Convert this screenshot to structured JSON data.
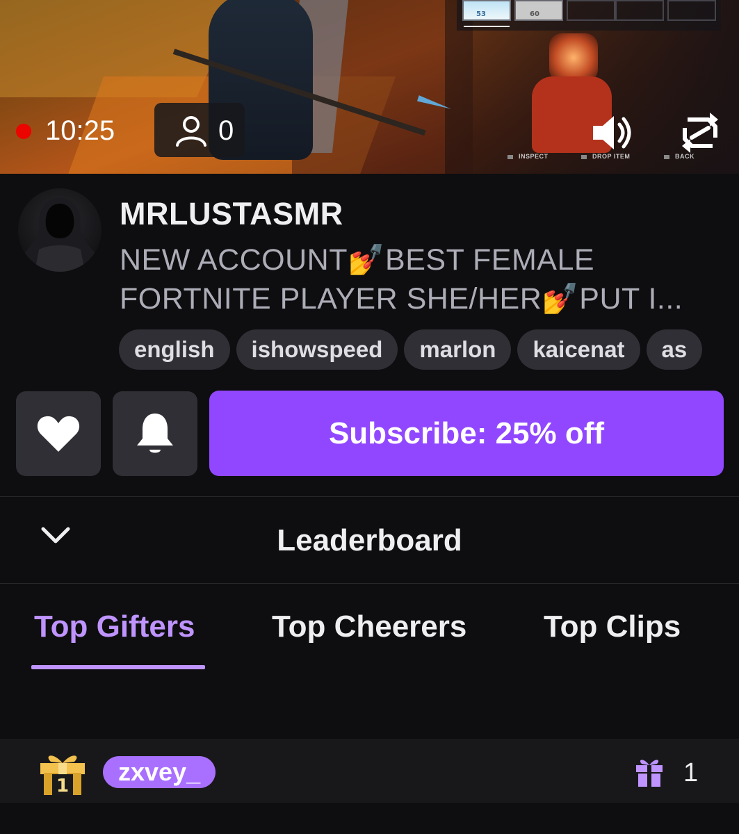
{
  "player": {
    "live_time": "10:25",
    "viewer_count": "0",
    "game_hints": [
      "INSPECT",
      "DROP ITEM",
      "BACK"
    ],
    "hud_slots": [
      "53",
      "60"
    ]
  },
  "channel": {
    "name": "MRLUSTASMR",
    "title": "NEW ACCOUNT💅BEST FEMALE FORTNITE PLAYER SHE/HER💅PUT I...",
    "tags": [
      "english",
      "ishowspeed",
      "marlon",
      "kaicenat",
      "as"
    ]
  },
  "actions": {
    "subscribe_label": "Subscribe: 25% off"
  },
  "leaderboard": {
    "title": "Leaderboard",
    "tabs": [
      {
        "label": "Top Gifters",
        "active": true
      },
      {
        "label": "Top Cheerers",
        "active": false
      },
      {
        "label": "Top Clips",
        "active": false
      }
    ],
    "entries": [
      {
        "rank": "1",
        "username": "zxvey_",
        "count": "1"
      }
    ]
  },
  "colors": {
    "accent": "#9147ff",
    "accent_light": "#bf94ff",
    "live_red": "#eb0400",
    "background": "#0e0e10"
  },
  "icons": [
    "person-icon",
    "volume-icon",
    "rotate-icon",
    "heart-icon",
    "bell-icon",
    "chevron-down-icon",
    "gift-rank-icon",
    "gift-icon"
  ]
}
